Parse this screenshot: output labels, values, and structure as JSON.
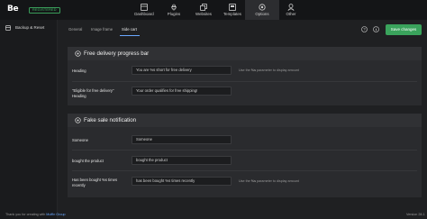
{
  "brand": {
    "logo_text": "Be",
    "badge": "REGISTERED"
  },
  "nav": [
    {
      "label": "Dashboard",
      "icon": "dashboard-icon"
    },
    {
      "label": "Plugins",
      "icon": "plugins-icon"
    },
    {
      "label": "Websites",
      "icon": "websites-icon"
    },
    {
      "label": "Templates",
      "icon": "templates-icon"
    },
    {
      "label": "Options",
      "icon": "options-icon",
      "active": true
    },
    {
      "label": "Other",
      "icon": "other-icon"
    }
  ],
  "sidebar": {
    "items": [
      {
        "label": "Backup & Reset",
        "icon": "backup-icon"
      }
    ]
  },
  "tabs": [
    {
      "label": "General"
    },
    {
      "label": "Image frame"
    },
    {
      "label": "Side cart",
      "active": true
    }
  ],
  "toolbar": {
    "save_label": "Save changes"
  },
  "sections": [
    {
      "title": "Free delivery progress bar",
      "rows": [
        {
          "label": "Heading",
          "value": "You are %s short for free delivery",
          "hint_pre": "Use the ",
          "hint_code": "%s",
          "hint_post": " parameter to display amount"
        },
        {
          "label": "\"Eligible for free delivery\" Heading",
          "value": "Your order qualifies for free shipping!"
        }
      ]
    },
    {
      "title": "Fake sale notification",
      "rows": [
        {
          "label": "Someone",
          "value": "Someone"
        },
        {
          "label": "bought the product",
          "value": "bought the product"
        },
        {
          "label": "Has been bought %s times recently",
          "value": "has been bought %s times recently",
          "hint_pre": "Use the ",
          "hint_code": "%s",
          "hint_post": " parameter to display amount"
        }
      ]
    }
  ],
  "footer": {
    "text": "Thank you for creating with ",
    "link": "Muffin Group",
    "version": "Version 28.1"
  },
  "colors": {
    "accent": "#3aa35c",
    "link": "#6aa8ff",
    "background": "#1f2022",
    "panel": "#2a2b2e"
  }
}
